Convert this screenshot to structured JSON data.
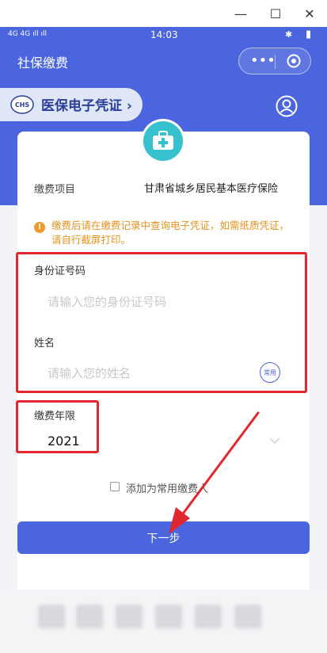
{
  "window": {
    "minimize": "—",
    "maximize": "☐",
    "close": "✕"
  },
  "status_bar": {
    "signal": "4G 4G ıll ıll",
    "time": "14:03",
    "bluetooth": "✱",
    "battery": "▮"
  },
  "header": {
    "title": "社保缴费",
    "more": "•••"
  },
  "voucher": {
    "logo_text": "CHS",
    "label": "医保电子凭证",
    "chevron": "›"
  },
  "card": {
    "item_label": "缴费项目",
    "item_value": "甘肃省城乡居民基本医疗保险"
  },
  "notice": {
    "icon": "!",
    "text": "缴费后请在缴费记录中查询电子凭证，如需纸质凭证，请自行截屏打印。"
  },
  "form": {
    "id_label": "身份证号码",
    "id_placeholder": "请输入您的身份证号码",
    "name_label": "姓名",
    "name_placeholder": "请输入您的姓名",
    "common_badge": "常用",
    "year_label": "缴费年限",
    "year_value": "2021"
  },
  "checkbox_label": "添加为常用缴费人",
  "next_button": "下一步",
  "colors": {
    "primary": "#4a65de",
    "accent_red": "#e1262e",
    "notice": "#e8921f",
    "medkit": "#36c1cf"
  }
}
